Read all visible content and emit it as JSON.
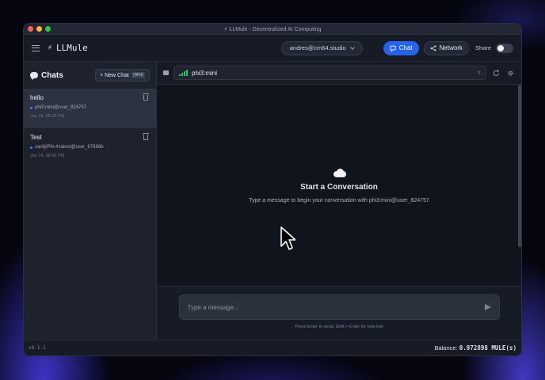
{
  "window": {
    "title": "⚡ LLMule - Decentralized AI Computing"
  },
  "appbar": {
    "brand_bolt": "⚡",
    "brand_name": "LLMule",
    "user": "andres@cm64.studio",
    "chat_label": "Chat",
    "network_label": "Network",
    "share_label": "Share",
    "share_enabled": false
  },
  "sidebar": {
    "title": "Chats",
    "new_chat_label": "+ New Chat",
    "new_chat_shortcut": "(⌘N)",
    "chats": [
      {
        "name": "hello",
        "model": "phi3:mini@user_824757",
        "date": "Jan 28, 05:28 PM",
        "selected": true
      },
      {
        "name": "Test",
        "model": "vanilj/Phi-4:latest@user_67898b",
        "date": "Jan 24, 08:50 PM",
        "selected": false
      }
    ]
  },
  "model_bar": {
    "selected_model": "phi3:mini",
    "select_arrow": "⇕"
  },
  "empty_state": {
    "title": "Start a Conversation",
    "subtitle": "Type a message to begin your conversation with phi3:mini@user_824757"
  },
  "composer": {
    "placeholder": "Type a message...",
    "hint": "Press Enter to send, Shift + Enter for new line"
  },
  "status": {
    "version": "v0.1.1",
    "balance_label": "Balance:",
    "balance_value": "0.972898 MULE(s)"
  },
  "colors": {
    "accent": "#2563eb",
    "model_dot": "#3b82f6",
    "signal": "#22c55e"
  }
}
